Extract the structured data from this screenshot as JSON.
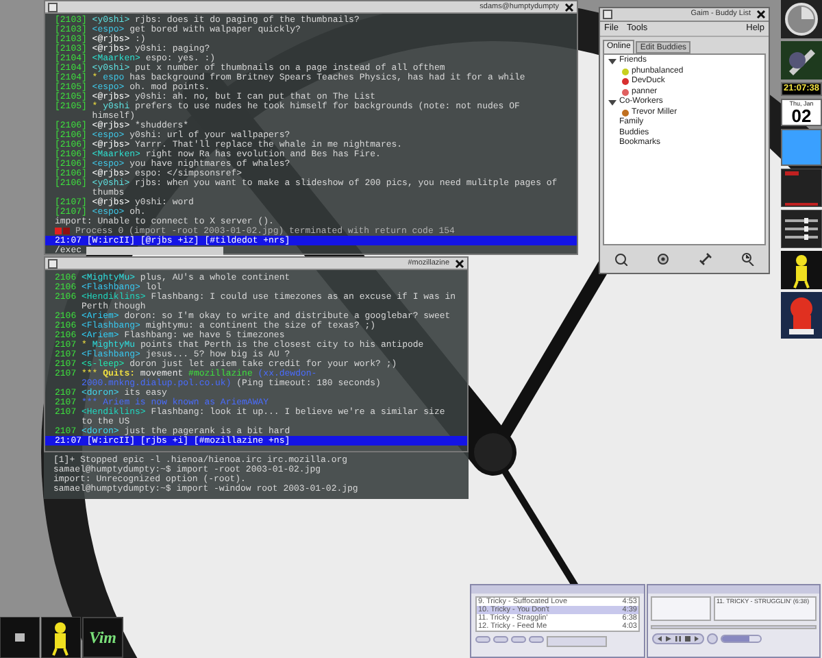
{
  "top_terminal": {
    "title": "sdams@humptydumpty",
    "lines": [
      {
        "kind": "msg",
        "time": "[2103]",
        "nick": "<y0shi>",
        "color": "#5fe3e3",
        "text": "rjbs:  does it do paging of the thumbnails?"
      },
      {
        "kind": "msg",
        "time": "[2103]",
        "nick": "<espo>",
        "color": "#3fc8e8",
        "text": "get bored with walpaper quickly?"
      },
      {
        "kind": "msg",
        "time": "[2103]",
        "nick": "<@rjbs>",
        "color": "#ffffff",
        "text": ":)"
      },
      {
        "kind": "msg",
        "time": "[2103]",
        "nick": "<@rjbs>",
        "color": "#ffffff",
        "text": "y0shi: paging?"
      },
      {
        "kind": "msg",
        "time": "[2104]",
        "nick": "<Maarken>",
        "color": "#2ee0d0",
        "text": "espo: yes. :)"
      },
      {
        "kind": "msg",
        "time": "[2104]",
        "nick": "<y0shi>",
        "color": "#5fe3e3",
        "text": "put x number of thumbnails on a page instead of all ofthem"
      },
      {
        "kind": "action",
        "time": "[2104]",
        "marker": "*",
        "nick": "espo",
        "color": "#3fc8e8",
        "text": "has background from Britney Spears Teaches Physics, has had it for a while"
      },
      {
        "kind": "msg",
        "time": "[2105]",
        "nick": "<espo>",
        "color": "#3fc8e8",
        "text": "oh. mod points."
      },
      {
        "kind": "msg",
        "time": "[2105]",
        "nick": "<@rjbs>",
        "color": "#ffffff",
        "text": "y0shi: ah.  no, but I can put that on The List"
      },
      {
        "kind": "action",
        "time": "[2105]",
        "marker": "*",
        "nick": "y0shi",
        "color": "#5fe3e3",
        "text": "prefers to use nudes he took himself for backgrounds (note: not nudes OF himself)"
      },
      {
        "kind": "msg",
        "time": "[2106]",
        "nick": "<@rjbs>",
        "color": "#ffffff",
        "text": "*shudders*"
      },
      {
        "kind": "msg",
        "time": "[2106]",
        "nick": "<espo>",
        "color": "#3fc8e8",
        "text": "y0shi: url of your wallpapers?"
      },
      {
        "kind": "msg",
        "time": "[2106]",
        "nick": "<@rjbs>",
        "color": "#ffffff",
        "text": "Yarrr.  That'll replace the whale in me nightmares."
      },
      {
        "kind": "msg",
        "time": "[2106]",
        "nick": "<Maarken>",
        "color": "#2ee0d0",
        "text": "right now Ra has evolution and Bes has Fire."
      },
      {
        "kind": "msg",
        "time": "[2106]",
        "nick": "<espo>",
        "color": "#3fc8e8",
        "text": "you have nightmares of whales?"
      },
      {
        "kind": "msg",
        "time": "[2106]",
        "nick": "<@rjbs>",
        "color": "#ffffff",
        "text": "espo: </simpsonsref>"
      },
      {
        "kind": "msg",
        "time": "[2106]",
        "nick": "<y0shi>",
        "color": "#5fe3e3",
        "text": "rjbs:  when you want to make a slideshow of 200 pics, you need mulitple pages of thumbs"
      },
      {
        "kind": "msg",
        "time": "[2107]",
        "nick": "<@rjbs>",
        "color": "#ffffff",
        "text": "y0shi: word"
      },
      {
        "kind": "msg",
        "time": "[2107]",
        "nick": "<espo>",
        "color": "#3fc8e8",
        "text": "oh."
      },
      {
        "kind": "system",
        "text": "import: Unable to connect to X server ()."
      },
      {
        "kind": "process",
        "text": "Process 0 (import -root 2003-01-02.jpg) terminated with return code 154"
      }
    ],
    "status": "21:07 [W:ircII] [@rjbs +iz] [#tildedot +nrs]",
    "input": "/exec"
  },
  "irc_window": {
    "title": "#mozillazine",
    "lines": [
      {
        "kind": "msg",
        "time": "2106",
        "nick": "<MightyMu>",
        "color": "#2ee0e0",
        "text": "plus, AU's a whole continent"
      },
      {
        "kind": "msg",
        "time": "2106",
        "nick": "<Flashbang>",
        "color": "#38c8f0",
        "text": "lol"
      },
      {
        "kind": "msg",
        "time": "2106",
        "nick": "<Hendiklins>",
        "color": "#20d8c0",
        "text": "Flashbang: I could use timezones as an excuse if I was in Perth though"
      },
      {
        "kind": "msg",
        "time": "2106",
        "nick": "<Ariem>",
        "color": "#30d0f8",
        "text": "doron: so I'm okay to write and distribute a googlebar? sweet"
      },
      {
        "kind": "msg",
        "time": "2106",
        "nick": "<Flashbang>",
        "color": "#38c8f0",
        "text": "mightymu: a continent the size of texas? ;)"
      },
      {
        "kind": "msg",
        "time": "2106",
        "nick": "<Ariem>",
        "color": "#30d0f8",
        "text": "Flashbang: we have 5 timezones"
      },
      {
        "kind": "action",
        "time": "2107",
        "marker": "*",
        "nick": "MightyMu",
        "color": "#2ee0e0",
        "text": "points that Perth is the closest city to his antipode"
      },
      {
        "kind": "msg",
        "time": "2107",
        "nick": "<Flashbang>",
        "color": "#38c8f0",
        "text": "jesus... 5? how big is AU ?"
      },
      {
        "kind": "msg",
        "time": "2107",
        "nick": "<s-leep>",
        "color": "#20e8b0",
        "text": "doron just let ariem take credit for your work? ;)"
      },
      {
        "kind": "quit",
        "time": "2107",
        "marker": "***",
        "label": "Quits:",
        "nick": "movement",
        "channel": "#mozillazine",
        "host": "(xx.dewdon-2000.mnkng.dialup.pol.co.uk)",
        "text": "(Ping timeout: 180 seconds)"
      },
      {
        "kind": "msg",
        "time": "2107",
        "nick": "<doron>",
        "color": "#40d8f0",
        "text": "its easy"
      },
      {
        "kind": "notice",
        "time": "2107",
        "marker": "***",
        "text": "Ariem is now known as AriemAWAY"
      },
      {
        "kind": "msg",
        "time": "2107",
        "nick": "<Hendiklins>",
        "color": "#20d8c0",
        "text": "Flashbang: look it up... I believe we're a similar size to the US"
      },
      {
        "kind": "msg",
        "time": "2107",
        "nick": "<doron>",
        "color": "#40d8f0",
        "text": "just the pagerank is a bit hard"
      }
    ],
    "status": "21:07 [W:ircII] [rjbs +i] [#mozillazine +ns]"
  },
  "shell": {
    "lines": [
      "[1]+  Stopped                 epic -l .hienoa/hienoa.irc irc.mozilla.org",
      "samael@humptydumpty:~$ import -root 2003-01-02.jpg",
      "import: Unrecognized option (-root).",
      "samael@humptydumpty:~$ import -window root 2003-01-02.jpg"
    ]
  },
  "buddy_list": {
    "title": "Gaim - Buddy List",
    "menu": [
      "File",
      "Tools",
      "Help"
    ],
    "tabs": [
      {
        "label": "Online",
        "selected": true
      },
      {
        "label": "Edit Buddies",
        "selected": false
      }
    ],
    "groups": [
      {
        "label": "Friends",
        "children": [
          {
            "label": "phunbalanced",
            "color": "#c8d020"
          },
          {
            "label": "DevDuck",
            "color": "#d83030"
          },
          {
            "label": "panner",
            "color": "#e06060"
          }
        ]
      },
      {
        "label": "Co-Workers",
        "children": [
          {
            "label": "Trevor Miller",
            "color": "#c07020"
          }
        ]
      },
      {
        "label": "Family"
      },
      {
        "label": "Buddies"
      },
      {
        "label": "Bookmarks"
      }
    ]
  },
  "dock": {
    "clock": "21:07:38",
    "date": "Thu, Jan",
    "day": "02"
  },
  "xmms": {
    "playlist": [
      {
        "title": "9. Tricky - Suffocated Love",
        "length": "4:53",
        "selected": false
      },
      {
        "title": "10. Tricky - You Don't",
        "length": "4:39",
        "selected": true
      },
      {
        "title": "11. Tricky - Stragglin'",
        "length": "6:38",
        "selected": false
      },
      {
        "title": "12. Tricky - Feed Me",
        "length": "4:03",
        "selected": false
      }
    ],
    "song": "11. TRICKY - STRUGGLIN' (6:38)",
    "volume": {
      "level": 0.7
    }
  },
  "launcher": {
    "logo_text": "Vim"
  }
}
